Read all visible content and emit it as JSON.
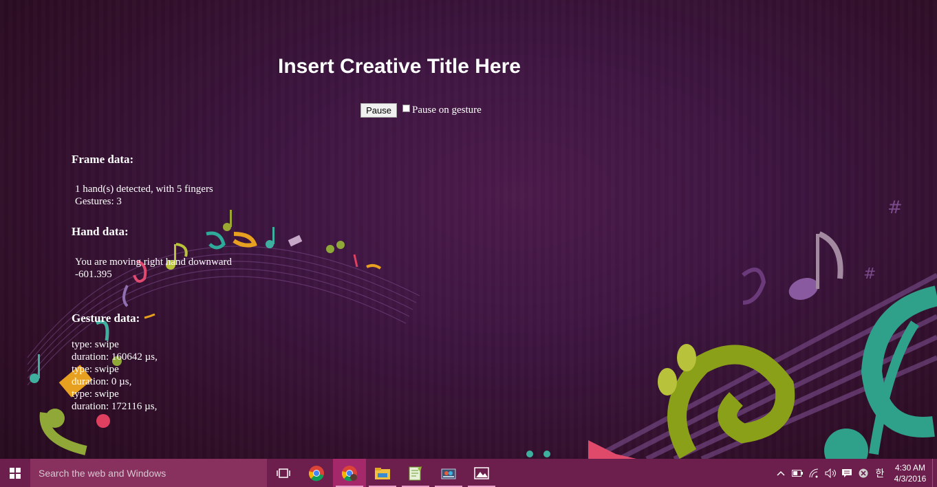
{
  "page": {
    "title": "Insert Creative Title Here",
    "pause_button": "Pause",
    "pause_on_gesture_label": "Pause on gesture"
  },
  "frame_data": {
    "heading": "Frame data:",
    "hands_line": "1 hand(s) detected, with 5 fingers",
    "gestures_line": "Gestures: 3"
  },
  "hand_data": {
    "heading": "Hand data:",
    "direction_line": "You are moving right hand downward",
    "value_line": "-601.395"
  },
  "gesture_data": {
    "heading": "Gesture data:",
    "lines": [
      "type: swipe",
      "duration: 160642 µs,",
      "type: swipe",
      "duration: 0 µs,",
      "type: swipe",
      "duration: 172116 µs,"
    ]
  },
  "taskbar": {
    "search_placeholder": "Search the web and Windows",
    "apps": [
      {
        "icon": "task-view-icon"
      },
      {
        "icon": "chrome-icon"
      },
      {
        "icon": "chrome-profile-icon"
      },
      {
        "icon": "file-explorer-icon"
      },
      {
        "icon": "notepad-plus-plus-icon"
      },
      {
        "icon": "app-window-icon"
      },
      {
        "icon": "photos-icon"
      }
    ],
    "time": "4:30 AM",
    "date": "4/3/2016",
    "ime": "한"
  },
  "colors": {
    "background": "#3d1540",
    "taskbar": "#6c1e4c",
    "search_box": "#88305e",
    "active_app": "#a5286a"
  }
}
